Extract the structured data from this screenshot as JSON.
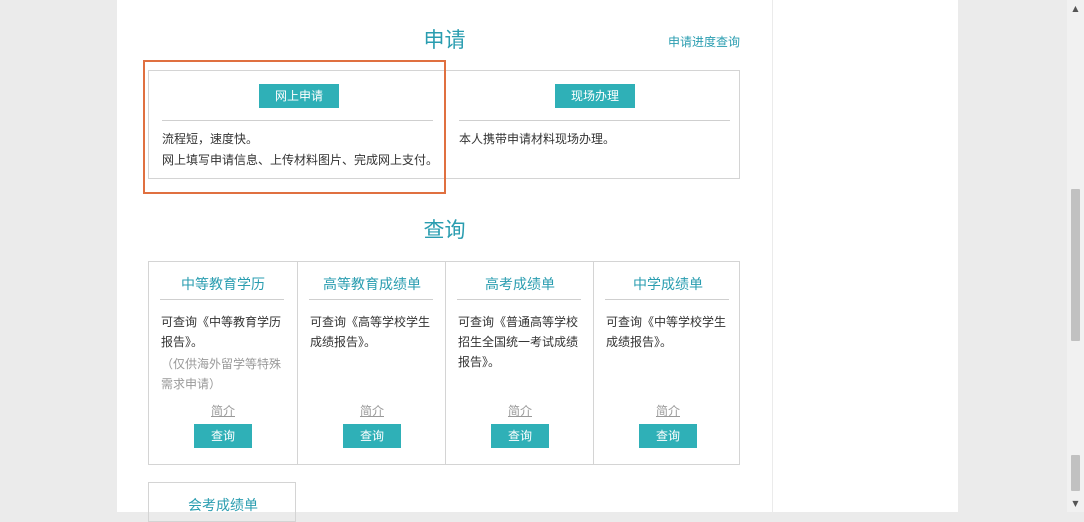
{
  "apply": {
    "title": "申请",
    "progress_link": "申请进度查询",
    "online": {
      "button": "网上申请",
      "desc_line1": "流程短，速度快。",
      "desc_line2": "网上填写申请信息、上传材料图片、完成网上支付。"
    },
    "onsite": {
      "button": "现场办理",
      "desc": "本人携带申请材料现场办理。"
    }
  },
  "query": {
    "title": "查询",
    "cards": [
      {
        "title": "中等教育学历",
        "desc": "可查询《中等教育学历报告》。",
        "note": "（仅供海外留学等特殊需求申请）",
        "intro": "简介",
        "button": "查询"
      },
      {
        "title": "高等教育成绩单",
        "desc": "可查询《高等学校学生成绩报告》。",
        "intro": "简介",
        "button": "查询"
      },
      {
        "title": "高考成绩单",
        "desc": "可查询《普通高等学校招生全国统一考试成绩报告》。",
        "intro": "简介",
        "button": "查询"
      },
      {
        "title": "中学成绩单",
        "desc": "可查询《中等学校学生成绩报告》。",
        "intro": "简介",
        "button": "查询"
      }
    ],
    "extra_card": {
      "title": "会考成绩单"
    }
  },
  "scrollbar": {
    "up_icon": "▲",
    "down_icon": "▼"
  },
  "colors": {
    "accent": "#2a9db0",
    "button": "#2fb0b7",
    "highlight": "#e07040",
    "background": "#ebebeb"
  }
}
